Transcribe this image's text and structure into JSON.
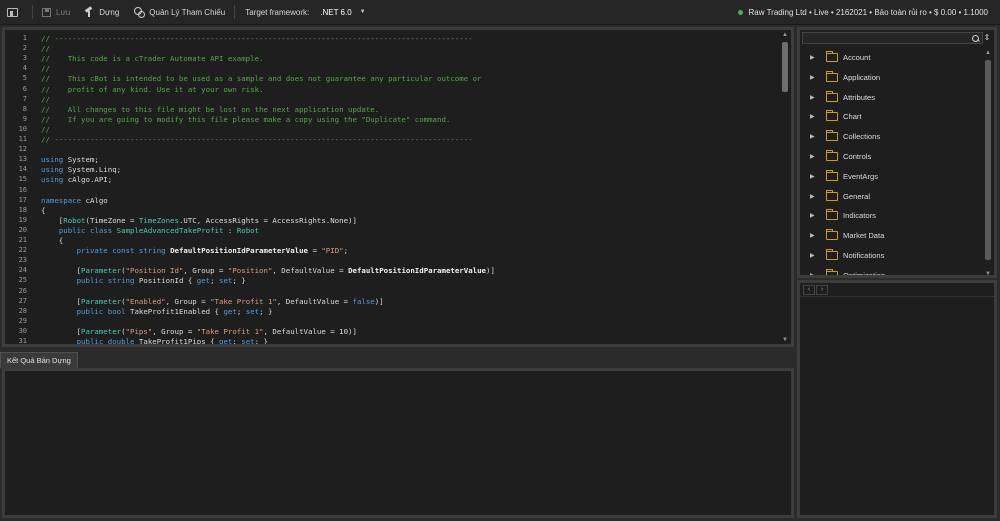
{
  "toolbar": {
    "save_label": "Lưu",
    "build_label": "Dựng",
    "references_label": "Quản Lý Tham Chiếu",
    "framework_label": "Target framework:",
    "framework_value": ".NET 6.0",
    "account_info": "Raw Trading Ltd • Live • 2162021 • Bảo toàn rủi ro • $ 0.00 • 1.1000",
    "status_color": "#4caf50"
  },
  "editor": {
    "lines": [
      {
        "n": "1",
        "parts": [
          {
            "c": "c-com",
            "t": "// ----------------------------------------------------------------------------------------------"
          }
        ]
      },
      {
        "n": "2",
        "parts": [
          {
            "c": "c-com",
            "t": "//"
          }
        ]
      },
      {
        "n": "3",
        "parts": [
          {
            "c": "c-com",
            "t": "//    This code is a cTrader Automate API example."
          }
        ]
      },
      {
        "n": "4",
        "parts": [
          {
            "c": "c-com",
            "t": "//"
          }
        ]
      },
      {
        "n": "5",
        "parts": [
          {
            "c": "c-com",
            "t": "//    This cBot is intended to be used as a sample and does not guarantee any particular outcome or"
          }
        ]
      },
      {
        "n": "6",
        "parts": [
          {
            "c": "c-com",
            "t": "//    profit of any kind. Use it at your own risk."
          }
        ]
      },
      {
        "n": "7",
        "parts": [
          {
            "c": "c-com",
            "t": "//"
          }
        ]
      },
      {
        "n": "8",
        "parts": [
          {
            "c": "c-com",
            "t": "//    All changes to this file might be lost on the next application update."
          }
        ]
      },
      {
        "n": "9",
        "parts": [
          {
            "c": "c-com",
            "t": "//    If you are going to modify this file please make a copy using the \"Duplicate\" command."
          }
        ]
      },
      {
        "n": "10",
        "parts": [
          {
            "c": "c-com",
            "t": "//"
          }
        ]
      },
      {
        "n": "11",
        "parts": [
          {
            "c": "c-com",
            "t": "// ----------------------------------------------------------------------------------------------"
          }
        ]
      },
      {
        "n": "12",
        "parts": []
      },
      {
        "n": "13",
        "parts": [
          {
            "c": "c-kw",
            "t": "using"
          },
          {
            "c": "",
            "t": " System;"
          }
        ]
      },
      {
        "n": "14",
        "parts": [
          {
            "c": "c-kw",
            "t": "using"
          },
          {
            "c": "",
            "t": " System.Linq;"
          }
        ]
      },
      {
        "n": "15",
        "parts": [
          {
            "c": "c-kw",
            "t": "using"
          },
          {
            "c": "",
            "t": " cAlgo.API;"
          }
        ]
      },
      {
        "n": "16",
        "parts": []
      },
      {
        "n": "17",
        "parts": [
          {
            "c": "c-kw",
            "t": "namespace"
          },
          {
            "c": "",
            "t": " cAlgo"
          }
        ]
      },
      {
        "n": "18",
        "parts": [
          {
            "c": "",
            "t": "{"
          }
        ]
      },
      {
        "n": "19",
        "parts": [
          {
            "c": "",
            "t": "    ["
          },
          {
            "c": "c-type",
            "t": "Robot"
          },
          {
            "c": "",
            "t": "(TimeZone = "
          },
          {
            "c": "c-type",
            "t": "TimeZones"
          },
          {
            "c": "",
            "t": ".UTC, AccessRights = AccessRights.None)]"
          }
        ]
      },
      {
        "n": "20",
        "parts": [
          {
            "c": "",
            "t": "    "
          },
          {
            "c": "c-kw",
            "t": "public class"
          },
          {
            "c": "",
            "t": " "
          },
          {
            "c": "c-type",
            "t": "SampleAdvancedTakeProfit"
          },
          {
            "c": "",
            "t": " : "
          },
          {
            "c": "c-type",
            "t": "Robot"
          }
        ]
      },
      {
        "n": "21",
        "parts": [
          {
            "c": "",
            "t": "    {"
          }
        ]
      },
      {
        "n": "22",
        "parts": [
          {
            "c": "",
            "t": "        "
          },
          {
            "c": "c-kw",
            "t": "private const string"
          },
          {
            "c": "",
            "t": " "
          },
          {
            "c": "c-bold",
            "t": "DefaultPositionIdParameterValue"
          },
          {
            "c": "",
            "t": " = "
          },
          {
            "c": "c-str",
            "t": "\"PID\""
          },
          {
            "c": "",
            "t": ";"
          }
        ]
      },
      {
        "n": "23",
        "parts": []
      },
      {
        "n": "24",
        "parts": [
          {
            "c": "",
            "t": "        ["
          },
          {
            "c": "c-type",
            "t": "Parameter"
          },
          {
            "c": "",
            "t": "("
          },
          {
            "c": "c-str",
            "t": "\"Position Id\""
          },
          {
            "c": "",
            "t": ", Group = "
          },
          {
            "c": "c-str",
            "t": "\"Position\""
          },
          {
            "c": "",
            "t": ", DefaultValue = "
          },
          {
            "c": "c-bold",
            "t": "DefaultPositionIdParameterValue"
          },
          {
            "c": "",
            "t": ")]"
          }
        ]
      },
      {
        "n": "25",
        "parts": [
          {
            "c": "",
            "t": "        "
          },
          {
            "c": "c-kw",
            "t": "public string"
          },
          {
            "c": "",
            "t": " PositionId { "
          },
          {
            "c": "c-kw",
            "t": "get"
          },
          {
            "c": "",
            "t": "; "
          },
          {
            "c": "c-kw",
            "t": "set"
          },
          {
            "c": "",
            "t": "; }"
          }
        ]
      },
      {
        "n": "26",
        "parts": []
      },
      {
        "n": "27",
        "parts": [
          {
            "c": "",
            "t": "        ["
          },
          {
            "c": "c-type",
            "t": "Parameter"
          },
          {
            "c": "",
            "t": "("
          },
          {
            "c": "c-str",
            "t": "\"Enabled\""
          },
          {
            "c": "",
            "t": ", Group = "
          },
          {
            "c": "c-str",
            "t": "\"Take Profit 1\""
          },
          {
            "c": "",
            "t": ", DefaultValue = "
          },
          {
            "c": "c-kw",
            "t": "false"
          },
          {
            "c": "",
            "t": ")]"
          }
        ]
      },
      {
        "n": "28",
        "parts": [
          {
            "c": "",
            "t": "        "
          },
          {
            "c": "c-kw",
            "t": "public bool"
          },
          {
            "c": "",
            "t": " TakeProfit1Enabled { "
          },
          {
            "c": "c-kw",
            "t": "get"
          },
          {
            "c": "",
            "t": "; "
          },
          {
            "c": "c-kw",
            "t": "set"
          },
          {
            "c": "",
            "t": "; }"
          }
        ]
      },
      {
        "n": "29",
        "parts": []
      },
      {
        "n": "30",
        "parts": [
          {
            "c": "",
            "t": "        ["
          },
          {
            "c": "c-type",
            "t": "Parameter"
          },
          {
            "c": "",
            "t": "("
          },
          {
            "c": "c-str",
            "t": "\"Pips\""
          },
          {
            "c": "",
            "t": ", Group = "
          },
          {
            "c": "c-str",
            "t": "\"Take Profit 1\""
          },
          {
            "c": "",
            "t": ", DefaultValue = 10)]"
          }
        ]
      },
      {
        "n": "31",
        "parts": [
          {
            "c": "",
            "t": "        "
          },
          {
            "c": "c-kw",
            "t": "public double"
          },
          {
            "c": "",
            "t": " TakeProfit1Pips { "
          },
          {
            "c": "c-kw",
            "t": "get"
          },
          {
            "c": "",
            "t": "; "
          },
          {
            "c": "c-kw",
            "t": "set"
          },
          {
            "c": "",
            "t": "; }"
          }
        ]
      }
    ]
  },
  "output": {
    "tab_label": "Kết Quả Bản Dựng"
  },
  "sidebar": {
    "search_placeholder": "",
    "items": [
      {
        "label": "Account"
      },
      {
        "label": "Application"
      },
      {
        "label": "Attributes"
      },
      {
        "label": "Chart"
      },
      {
        "label": "Collections"
      },
      {
        "label": "Controls"
      },
      {
        "label": "EventArgs"
      },
      {
        "label": "General"
      },
      {
        "label": "Indicators"
      },
      {
        "label": "Market Data"
      },
      {
        "label": "Notifications"
      },
      {
        "label": "Optimization"
      }
    ]
  }
}
